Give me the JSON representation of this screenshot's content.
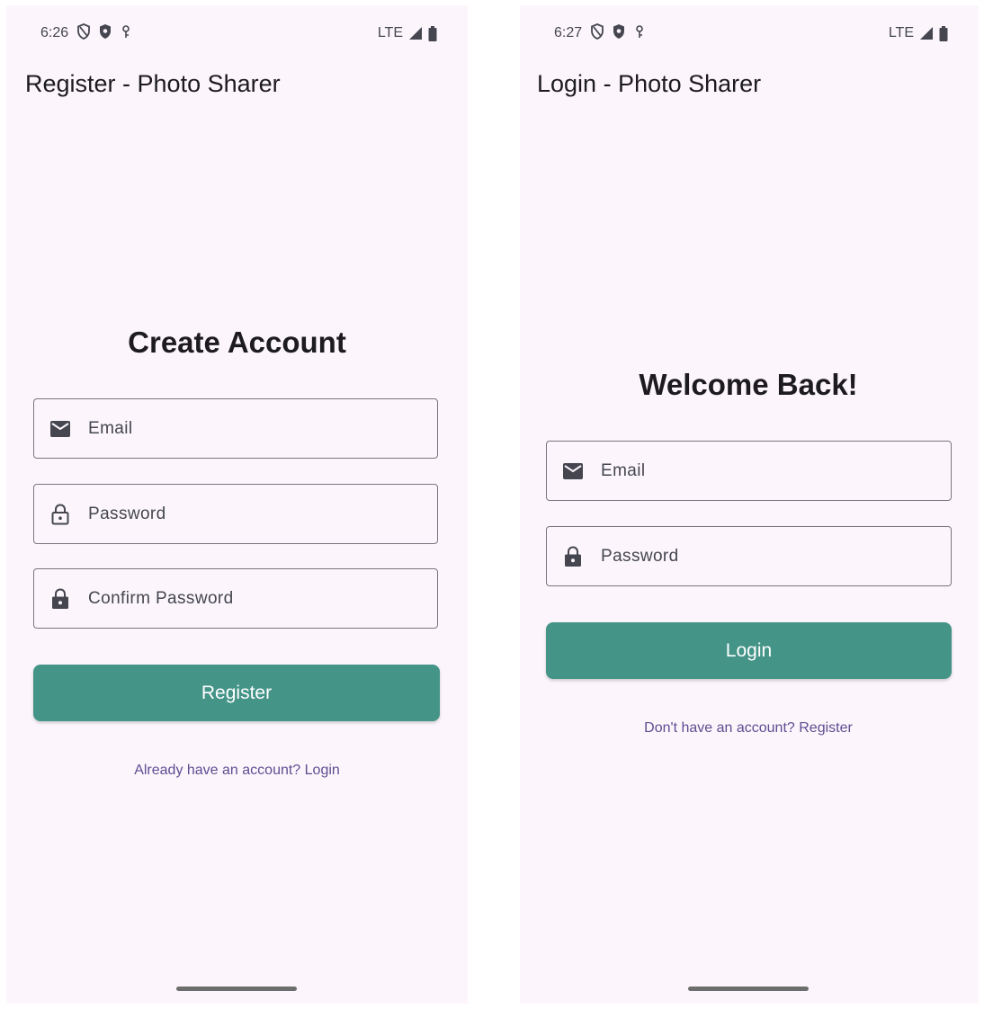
{
  "register_screen": {
    "status": {
      "time": "6:26",
      "network": "LTE"
    },
    "app_title": "Register - Photo Sharer",
    "heading": "Create Account",
    "fields": {
      "email": "Email",
      "password": "Password",
      "confirm_password": "Confirm Password"
    },
    "primary_button": "Register",
    "link": "Already have an account? Login"
  },
  "login_screen": {
    "status": {
      "time": "6:27",
      "network": "LTE"
    },
    "app_title": "Login - Photo Sharer",
    "heading": "Welcome Back!",
    "fields": {
      "email": "Email",
      "password": "Password"
    },
    "primary_button": "Login",
    "link": "Don't have an account? Register"
  },
  "colors": {
    "background": "#fcf6fc",
    "primary": "#449488",
    "link": "#5d4e92",
    "outline": "#79747e"
  },
  "icons": [
    "shield-outline-icon",
    "shield-filled-icon",
    "vpn-key-icon",
    "signal-icon",
    "battery-icon",
    "mail-icon",
    "lock-open-icon",
    "lock-icon"
  ]
}
